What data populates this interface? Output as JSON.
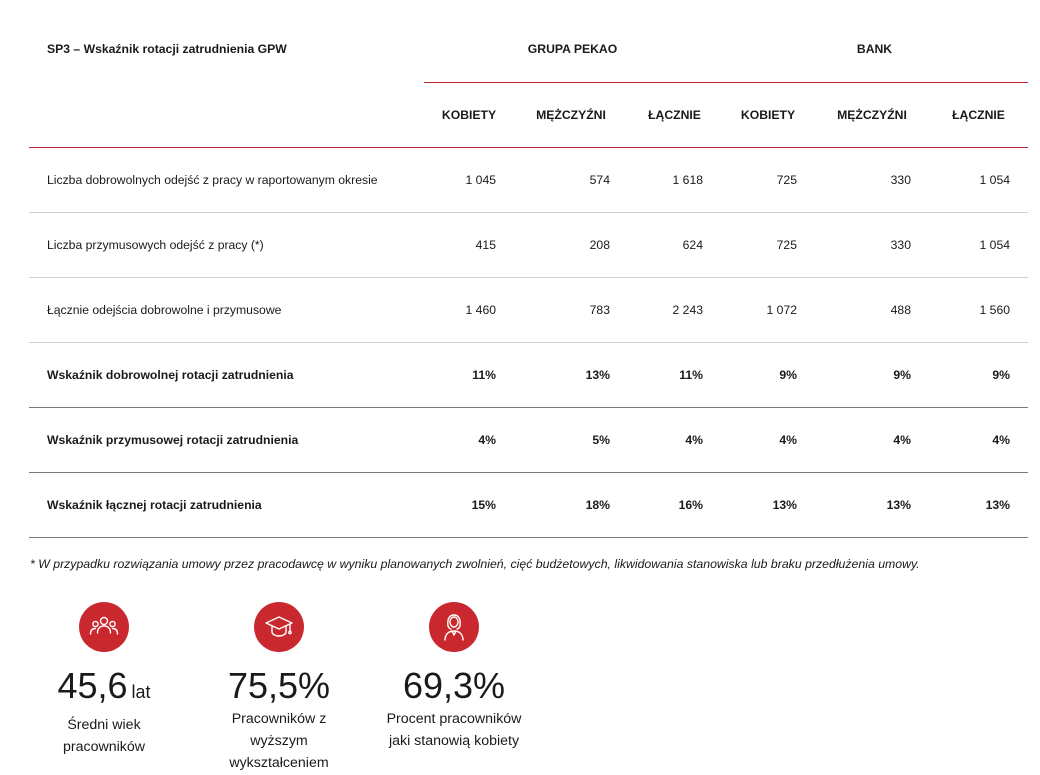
{
  "table": {
    "title": "SP3 – Wskaźnik rotacji zatrudnienia GPW",
    "group_pekao": "GRUPA PEKAO",
    "group_bank": "BANK",
    "columns": [
      "KOBIETY",
      "MĘŻCZYŹNI",
      "ŁĄCZNIE",
      "KOBIETY",
      "MĘŻCZYŹNI",
      "ŁĄCZNIE"
    ],
    "rows": [
      {
        "label": "Liczba dobrowolnych odejść z pracy w raportowanym okresie",
        "values": [
          "1 045",
          "574",
          "1 618",
          "725",
          "330",
          "1 054"
        ]
      },
      {
        "label": "Liczba przymusowych odejść z pracy (*)",
        "values": [
          "415",
          "208",
          "624",
          "725",
          "330",
          "1 054"
        ]
      },
      {
        "label": "Łącznie odejścia dobrowolne i przymusowe",
        "values": [
          "1 460",
          "783",
          "2 243",
          "1 072",
          "488",
          "1 560"
        ]
      },
      {
        "label": "Wskaźnik dobrowolnej rotacji zatrudnienia",
        "values": [
          "11%",
          "13%",
          "11%",
          "9%",
          "9%",
          "9%"
        ]
      },
      {
        "label": "Wskaźnik przymusowej rotacji zatrudnienia",
        "values": [
          "4%",
          "5%",
          "4%",
          "4%",
          "4%",
          "4%"
        ]
      },
      {
        "label": "Wskaźnik łącznej rotacji zatrudnienia",
        "values": [
          "15%",
          "18%",
          "16%",
          "13%",
          "13%",
          "13%"
        ]
      }
    ]
  },
  "footnote": "* W przypadku rozwiązania umowy przez pracodawcę w wyniku planowanych zwolnień, cięć budżetowych, likwidowania stanowiska lub braku przedłużenia umowy.",
  "stats": [
    {
      "icon": "people-icon",
      "value": "45,6",
      "unit": "lat",
      "desc_line1": "Średni wiek",
      "desc_line2": "pracowników",
      "desc_line3": ""
    },
    {
      "icon": "graduation-cap-icon",
      "value": "75,5%",
      "unit": "",
      "desc_line1": "Pracowników z",
      "desc_line2": "wyższym",
      "desc_line3": "wykształceniem"
    },
    {
      "icon": "woman-icon",
      "value": "69,3%",
      "unit": "",
      "desc_line1": "Procent pracowników",
      "desc_line2": "jaki stanowią kobiety",
      "desc_line3": ""
    }
  ],
  "colors": {
    "accent": "#c8282e",
    "divider": "#cfcfcf"
  }
}
